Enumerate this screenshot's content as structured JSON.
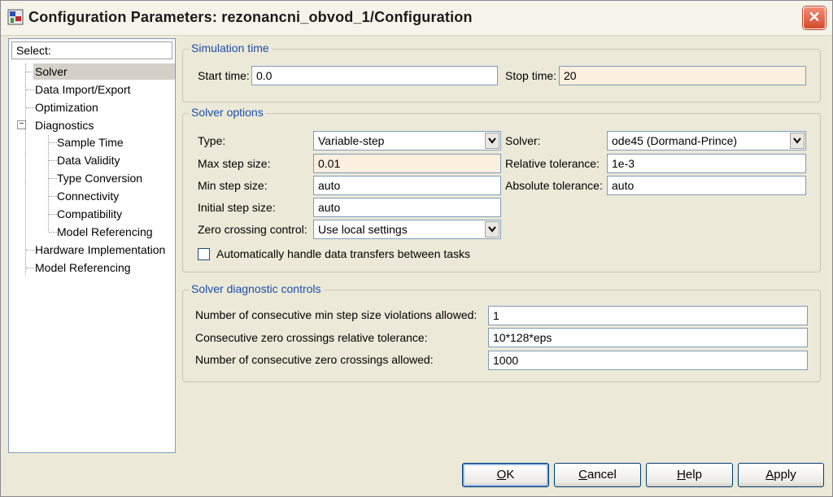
{
  "window": {
    "title": "Configuration Parameters: rezonancni_obvod_1/Configuration",
    "close_glyph": "✕"
  },
  "tree": {
    "header": "Select:",
    "items": [
      {
        "label": "Solver",
        "selected": true
      },
      {
        "label": "Data Import/Export"
      },
      {
        "label": "Optimization"
      },
      {
        "label": "Diagnostics",
        "expander": "−"
      },
      {
        "label": "Sample Time"
      },
      {
        "label": "Data Validity"
      },
      {
        "label": "Type Conversion"
      },
      {
        "label": "Connectivity"
      },
      {
        "label": "Compatibility"
      },
      {
        "label": "Model Referencing"
      },
      {
        "label": "Hardware Implementation"
      },
      {
        "label": "Model Referencing"
      }
    ]
  },
  "simulation_time": {
    "legend": "Simulation time",
    "start_label": "Start time:",
    "start_value": "0.0",
    "stop_label": "Stop time:",
    "stop_value": "20"
  },
  "solver_options": {
    "legend": "Solver options",
    "type_label": "Type:",
    "type_value": "Variable-step",
    "solver_label": "Solver:",
    "solver_value": "ode45 (Dormand-Prince)",
    "max_step_label": "Max step size:",
    "max_step_value": "0.01",
    "rel_tol_label": "Relative tolerance:",
    "rel_tol_value": "1e-3",
    "min_step_label": "Min step size:",
    "min_step_value": "auto",
    "abs_tol_label": "Absolute tolerance:",
    "abs_tol_value": "auto",
    "init_step_label": "Initial step size:",
    "init_step_value": "auto",
    "zero_cross_label": "Zero crossing control:",
    "zero_cross_value": "Use local settings",
    "auto_transfer_label": "Automatically handle data transfers between tasks",
    "auto_transfer_checked": false
  },
  "diagnostic_controls": {
    "legend": "Solver diagnostic controls",
    "min_step_violations_label": "Number of consecutive min step size violations allowed:",
    "min_step_violations_value": "1",
    "zc_rel_tol_label": "Consecutive zero crossings relative tolerance:",
    "zc_rel_tol_value": "10*128*eps",
    "zc_allowed_label": "Number of consecutive zero crossings allowed:",
    "zc_allowed_value": "1000"
  },
  "buttons": {
    "ok": {
      "mnemonic": "O",
      "rest": "K"
    },
    "cancel": {
      "mnemonic": "C",
      "rest": "ancel"
    },
    "help": {
      "mnemonic": "H",
      "rest": "elp"
    },
    "apply": {
      "mnemonic": "A",
      "rest": "pply"
    }
  },
  "icons": {
    "app": "simulink-config-icon",
    "combo": "chevron-down-icon",
    "close": "close-icon"
  },
  "colors": {
    "accent_legend": "#1b4ea8",
    "modified_field": "#fbefdf",
    "window_bg": "#ece9d8"
  }
}
